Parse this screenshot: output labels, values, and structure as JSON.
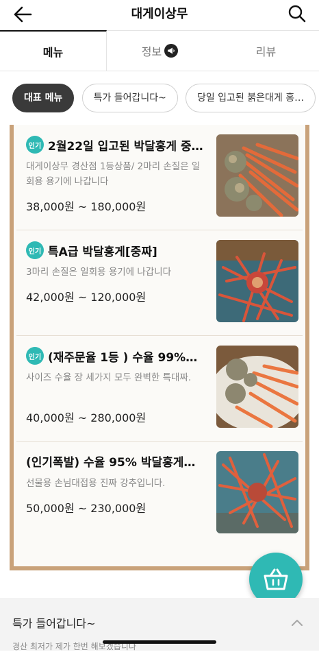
{
  "header": {
    "title": "대게이상무",
    "back_icon": "arrow-left-icon",
    "search_icon": "search-icon"
  },
  "tabs": [
    {
      "label": "메뉴",
      "active": true
    },
    {
      "label": "정보",
      "active": false,
      "badge_icon": "megaphone-icon"
    },
    {
      "label": "리뷰",
      "active": false
    }
  ],
  "chips": [
    {
      "label": "대표 메뉴",
      "active": true
    },
    {
      "label": "특가 들어갑니다~",
      "active": false
    },
    {
      "label": "당일 입고된  붉은대게 홍…",
      "active": false
    }
  ],
  "badge_label": "인기",
  "menu_items": [
    {
      "badge": true,
      "name": "2월22일 입고된 박달홍게 중…",
      "desc": "대게이상무 경산점 1등상품/ 2마리 손질은 일회용 용기에 나갑니다",
      "price": "38,000원 ~ 180,000원"
    },
    {
      "badge": true,
      "name": "특A급 박달홍게[중짜]",
      "desc": "3마리 손질은 일회용 용기에 나갑니다",
      "price": "42,000원 ~ 120,000원"
    },
    {
      "badge": true,
      "name": "(재주문율 1등 ) 수율 99%…",
      "desc": "사이즈 수율 장 세가지 모두 완벽한 특대짜.",
      "price": "40,000원 ~ 280,000원"
    },
    {
      "badge": false,
      "name": "(인기폭발) 수율 95% 박달홍게…",
      "desc": "선물용 손님대접용 진짜 강추입니다.",
      "price": "50,000원 ~ 230,000원"
    }
  ],
  "cart_icon": "basket-icon",
  "bottom_section": {
    "title": "특가 들어갑니다~",
    "subtitle": "경산 최저가 제가 한번 해보겠습니다",
    "toggle_icon": "chevron-up-icon"
  },
  "colors": {
    "accent": "#2fb9b4",
    "board_frame": "#c9a27a",
    "chip_active": "#3a3a3a"
  }
}
